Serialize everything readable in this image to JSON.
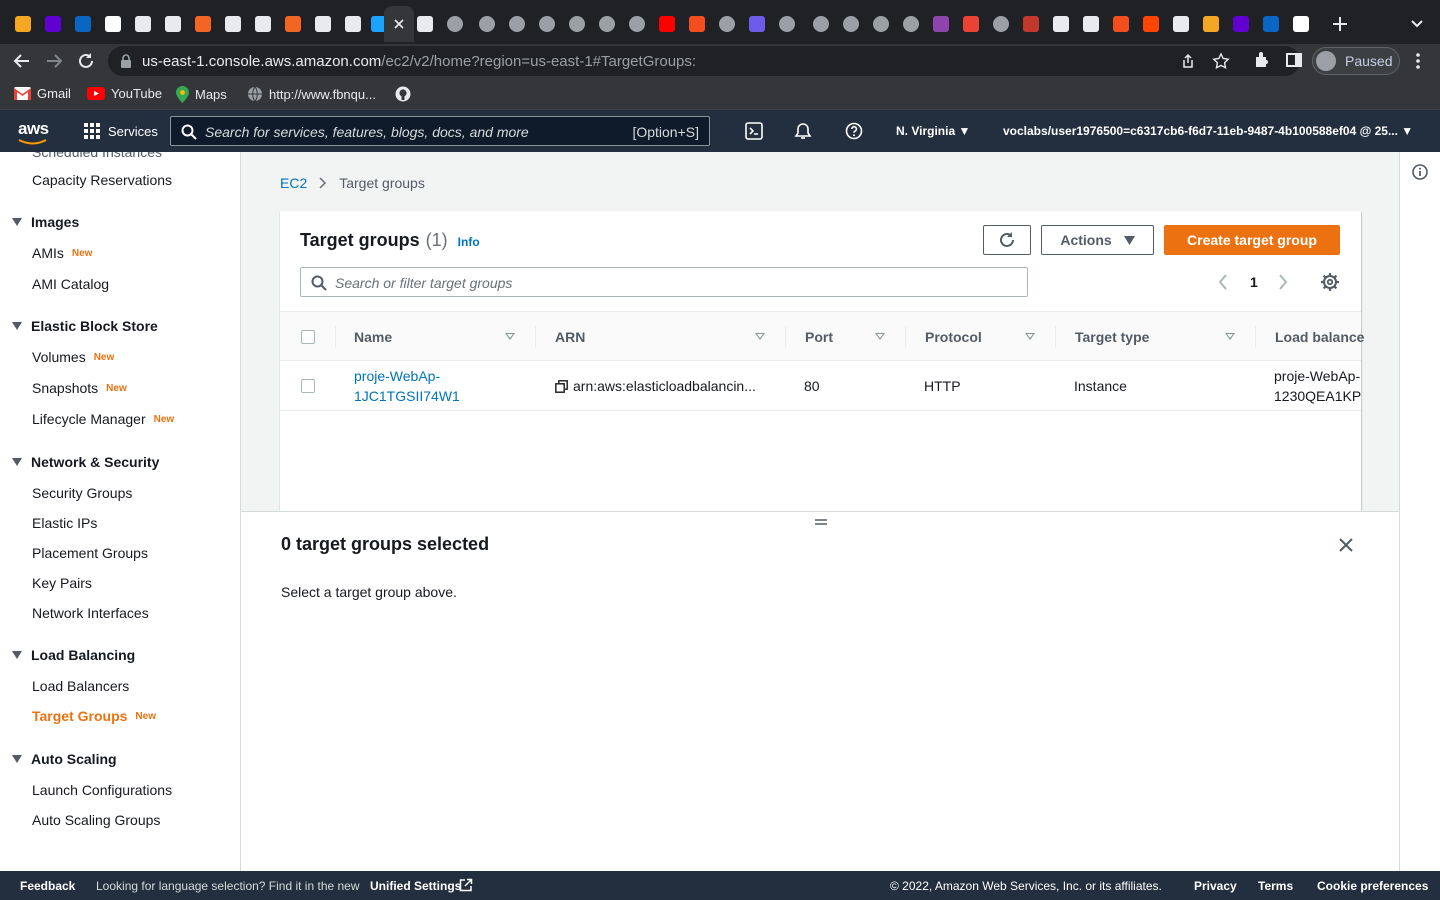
{
  "browser": {
    "address_host": "us-east-1.console.aws.amazon.com",
    "address_path": "/ec2/v2/home?region=us-east-1#TargetGroups:",
    "profile_status": "Paused",
    "bookmarks": [
      {
        "label": "Gmail",
        "icon": "gmail-icon"
      },
      {
        "label": "YouTube",
        "icon": "youtube-icon"
      },
      {
        "label": "Maps",
        "icon": "maps-icon"
      },
      {
        "label": "http://www.fbnqu...",
        "icon": "globe-icon"
      }
    ]
  },
  "aws_nav": {
    "logo": "aws",
    "services_label": "Services",
    "search_placeholder": "Search for services, features, blogs, docs, and more",
    "search_shortcut": "[Option+S]",
    "region": "N. Virginia",
    "account": "voclabs/user1976500=c6317cb6-f6d7-11eb-9487-4b100588ef04 @ 25..."
  },
  "sidebar": {
    "truncated_item": "Scheduled Instances",
    "capacity": "Capacity Reservations",
    "sections": [
      {
        "title": "Images",
        "items": [
          {
            "label": "AMIs",
            "badge": "New"
          },
          {
            "label": "AMI Catalog",
            "badge": ""
          }
        ]
      },
      {
        "title": "Elastic Block Store",
        "items": [
          {
            "label": "Volumes",
            "badge": "New"
          },
          {
            "label": "Snapshots",
            "badge": "New"
          },
          {
            "label": "Lifecycle Manager",
            "badge": "New"
          }
        ]
      },
      {
        "title": "Network & Security",
        "items": [
          {
            "label": "Security Groups",
            "badge": ""
          },
          {
            "label": "Elastic IPs",
            "badge": ""
          },
          {
            "label": "Placement Groups",
            "badge": ""
          },
          {
            "label": "Key Pairs",
            "badge": ""
          },
          {
            "label": "Network Interfaces",
            "badge": ""
          }
        ]
      },
      {
        "title": "Load Balancing",
        "items": [
          {
            "label": "Load Balancers",
            "badge": ""
          },
          {
            "label": "Target Groups",
            "badge": "New"
          }
        ]
      },
      {
        "title": "Auto Scaling",
        "items": [
          {
            "label": "Launch Configurations",
            "badge": ""
          },
          {
            "label": "Auto Scaling Groups",
            "badge": ""
          }
        ]
      }
    ]
  },
  "breadcrumb": {
    "root": "EC2",
    "current": "Target groups"
  },
  "panel": {
    "title": "Target groups",
    "count": "(1)",
    "info": "Info",
    "actions_label": "Actions",
    "create_label": "Create target group",
    "filter_placeholder": "Search or filter target groups",
    "page": "1"
  },
  "table": {
    "columns": [
      "Name",
      "ARN",
      "Port",
      "Protocol",
      "Target type",
      "Load balance"
    ],
    "rows": [
      {
        "name_line1": "proje-WebAp-",
        "name_line2": "1JC1TGSII74W1",
        "arn": "arn:aws:elasticloadbalancin...",
        "port": "80",
        "protocol": "HTTP",
        "target_type": "Instance",
        "lb_line1": "proje-WebAp-",
        "lb_line2": "1230QEA1KP"
      }
    ]
  },
  "details": {
    "heading": "0 target groups selected",
    "message": "Select a target group above."
  },
  "footer": {
    "feedback": "Feedback",
    "lang_prefix": "Looking for language selection? Find it in the new",
    "unified": "Unified Settings",
    "copyright": "© 2022, Amazon Web Services, Inc. or its affiliates.",
    "privacy": "Privacy",
    "terms": "Terms",
    "cookies": "Cookie preferences"
  }
}
